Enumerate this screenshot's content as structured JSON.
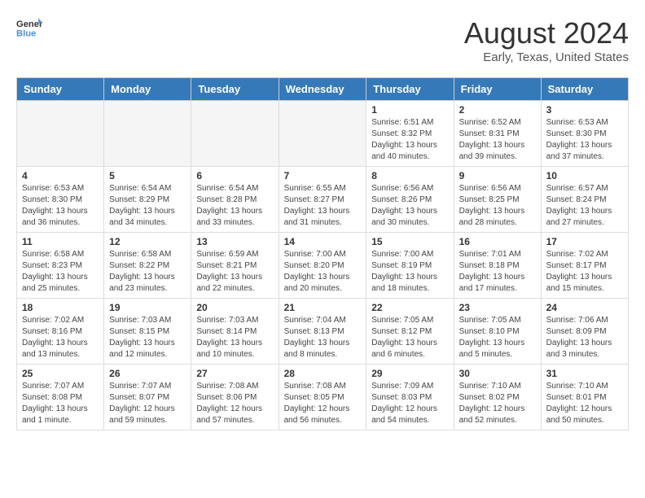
{
  "header": {
    "logo_general": "General",
    "logo_blue": "Blue",
    "title": "August 2024",
    "subtitle": "Early, Texas, United States"
  },
  "calendar": {
    "days_of_week": [
      "Sunday",
      "Monday",
      "Tuesday",
      "Wednesday",
      "Thursday",
      "Friday",
      "Saturday"
    ],
    "weeks": [
      [
        {
          "day": "",
          "empty": true
        },
        {
          "day": "",
          "empty": true
        },
        {
          "day": "",
          "empty": true
        },
        {
          "day": "",
          "empty": true
        },
        {
          "day": "1",
          "sunrise": "6:51 AM",
          "sunset": "8:32 PM",
          "daylight": "13 hours and 40 minutes."
        },
        {
          "day": "2",
          "sunrise": "6:52 AM",
          "sunset": "8:31 PM",
          "daylight": "13 hours and 39 minutes."
        },
        {
          "day": "3",
          "sunrise": "6:53 AM",
          "sunset": "8:30 PM",
          "daylight": "13 hours and 37 minutes."
        }
      ],
      [
        {
          "day": "4",
          "sunrise": "6:53 AM",
          "sunset": "8:30 PM",
          "daylight": "13 hours and 36 minutes."
        },
        {
          "day": "5",
          "sunrise": "6:54 AM",
          "sunset": "8:29 PM",
          "daylight": "13 hours and 34 minutes."
        },
        {
          "day": "6",
          "sunrise": "6:54 AM",
          "sunset": "8:28 PM",
          "daylight": "13 hours and 33 minutes."
        },
        {
          "day": "7",
          "sunrise": "6:55 AM",
          "sunset": "8:27 PM",
          "daylight": "13 hours and 31 minutes."
        },
        {
          "day": "8",
          "sunrise": "6:56 AM",
          "sunset": "8:26 PM",
          "daylight": "13 hours and 30 minutes."
        },
        {
          "day": "9",
          "sunrise": "6:56 AM",
          "sunset": "8:25 PM",
          "daylight": "13 hours and 28 minutes."
        },
        {
          "day": "10",
          "sunrise": "6:57 AM",
          "sunset": "8:24 PM",
          "daylight": "13 hours and 27 minutes."
        }
      ],
      [
        {
          "day": "11",
          "sunrise": "6:58 AM",
          "sunset": "8:23 PM",
          "daylight": "13 hours and 25 minutes."
        },
        {
          "day": "12",
          "sunrise": "6:58 AM",
          "sunset": "8:22 PM",
          "daylight": "13 hours and 23 minutes."
        },
        {
          "day": "13",
          "sunrise": "6:59 AM",
          "sunset": "8:21 PM",
          "daylight": "13 hours and 22 minutes."
        },
        {
          "day": "14",
          "sunrise": "7:00 AM",
          "sunset": "8:20 PM",
          "daylight": "13 hours and 20 minutes."
        },
        {
          "day": "15",
          "sunrise": "7:00 AM",
          "sunset": "8:19 PM",
          "daylight": "13 hours and 18 minutes."
        },
        {
          "day": "16",
          "sunrise": "7:01 AM",
          "sunset": "8:18 PM",
          "daylight": "13 hours and 17 minutes."
        },
        {
          "day": "17",
          "sunrise": "7:02 AM",
          "sunset": "8:17 PM",
          "daylight": "13 hours and 15 minutes."
        }
      ],
      [
        {
          "day": "18",
          "sunrise": "7:02 AM",
          "sunset": "8:16 PM",
          "daylight": "13 hours and 13 minutes."
        },
        {
          "day": "19",
          "sunrise": "7:03 AM",
          "sunset": "8:15 PM",
          "daylight": "13 hours and 12 minutes."
        },
        {
          "day": "20",
          "sunrise": "7:03 AM",
          "sunset": "8:14 PM",
          "daylight": "13 hours and 10 minutes."
        },
        {
          "day": "21",
          "sunrise": "7:04 AM",
          "sunset": "8:13 PM",
          "daylight": "13 hours and 8 minutes."
        },
        {
          "day": "22",
          "sunrise": "7:05 AM",
          "sunset": "8:12 PM",
          "daylight": "13 hours and 6 minutes."
        },
        {
          "day": "23",
          "sunrise": "7:05 AM",
          "sunset": "8:10 PM",
          "daylight": "13 hours and 5 minutes."
        },
        {
          "day": "24",
          "sunrise": "7:06 AM",
          "sunset": "8:09 PM",
          "daylight": "13 hours and 3 minutes."
        }
      ],
      [
        {
          "day": "25",
          "sunrise": "7:07 AM",
          "sunset": "8:08 PM",
          "daylight": "13 hours and 1 minute."
        },
        {
          "day": "26",
          "sunrise": "7:07 AM",
          "sunset": "8:07 PM",
          "daylight": "12 hours and 59 minutes."
        },
        {
          "day": "27",
          "sunrise": "7:08 AM",
          "sunset": "8:06 PM",
          "daylight": "12 hours and 57 minutes."
        },
        {
          "day": "28",
          "sunrise": "7:08 AM",
          "sunset": "8:05 PM",
          "daylight": "12 hours and 56 minutes."
        },
        {
          "day": "29",
          "sunrise": "7:09 AM",
          "sunset": "8:03 PM",
          "daylight": "12 hours and 54 minutes."
        },
        {
          "day": "30",
          "sunrise": "7:10 AM",
          "sunset": "8:02 PM",
          "daylight": "12 hours and 52 minutes."
        },
        {
          "day": "31",
          "sunrise": "7:10 AM",
          "sunset": "8:01 PM",
          "daylight": "12 hours and 50 minutes."
        }
      ]
    ]
  }
}
